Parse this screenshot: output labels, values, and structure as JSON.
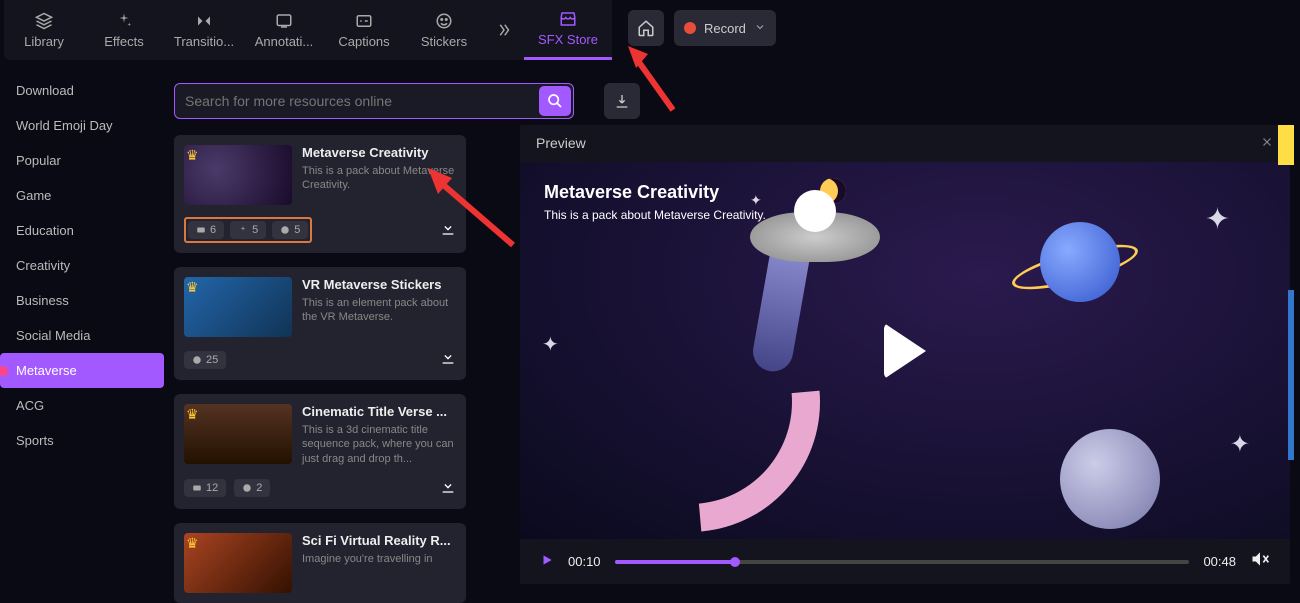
{
  "tabs": {
    "library": "Library",
    "effects": "Effects",
    "transitions": "Transitio...",
    "annotations": "Annotati...",
    "captions": "Captions",
    "stickers": "Stickers",
    "sfx": "SFX Store"
  },
  "topbar": {
    "record": "Record"
  },
  "sidebar": {
    "items": [
      "Download",
      "World Emoji Day",
      "Popular",
      "Game",
      "Education",
      "Creativity",
      "Business",
      "Social Media",
      "Metaverse",
      "ACG",
      "Sports"
    ],
    "activeIndex": 8
  },
  "search": {
    "placeholder": "Search for more resources online"
  },
  "packs": [
    {
      "title": "Metaverse Creativity",
      "desc": "This is a pack about Metaverse Creativity.",
      "stats": [
        {
          "icon": "caption",
          "n": "6"
        },
        {
          "icon": "effect",
          "n": "5"
        },
        {
          "icon": "sticker",
          "n": "5"
        }
      ],
      "highlighted": true,
      "thumb": "space"
    },
    {
      "title": "VR Metaverse Stickers",
      "desc": "This is an element pack about the VR Metaverse.",
      "stats": [
        {
          "icon": "sticker",
          "n": "25"
        }
      ],
      "highlighted": false,
      "thumb": "vr"
    },
    {
      "title": "Cinematic Title Verse ...",
      "desc": "This is a 3d cinematic title sequence pack, where you can just drag and drop th...",
      "stats": [
        {
          "icon": "caption",
          "n": "12"
        },
        {
          "icon": "sticker",
          "n": "2"
        }
      ],
      "highlighted": false,
      "thumb": "cine"
    },
    {
      "title": "Sci Fi Virtual Reality R...",
      "desc": "Imagine you're travelling in",
      "stats": [],
      "highlighted": false,
      "thumb": "sci"
    }
  ],
  "preview": {
    "header": "Preview",
    "title": "Metaverse Creativity",
    "sub": "This is a pack about Metaverse Creativity.",
    "current": "00:10",
    "total": "00:48"
  }
}
